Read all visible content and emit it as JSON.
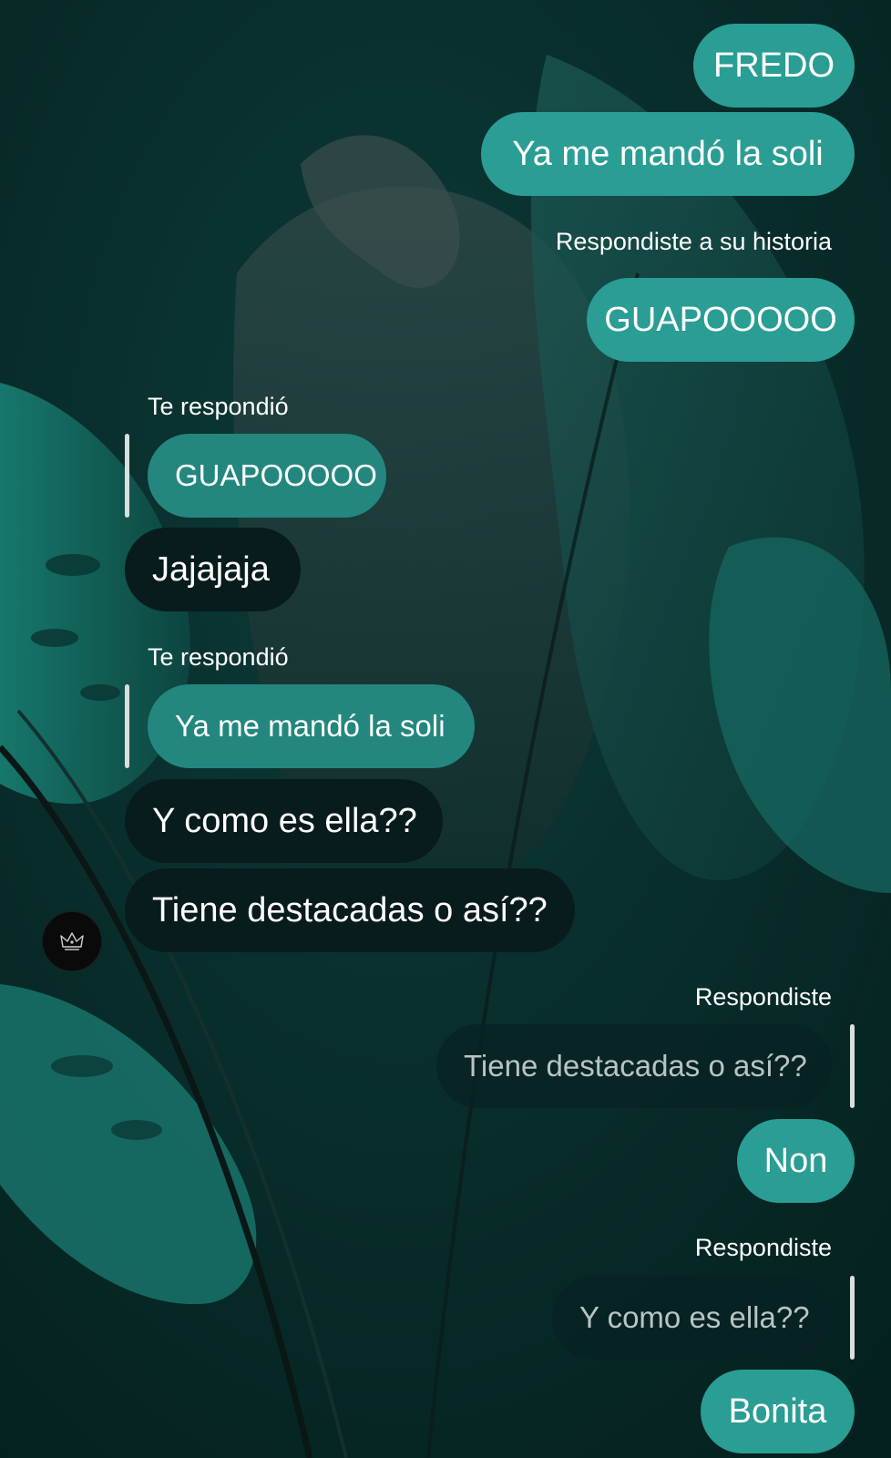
{
  "colors": {
    "background": "#062a28",
    "outgoing_bubble": "#2a9d94",
    "incoming_bubble": "#081b1d",
    "reply_quote_bubble": "#23877f"
  },
  "messages": {
    "m1": "FREDO",
    "m2": "Ya me mandó la soli",
    "label_story_reply": "Respondiste a su historia",
    "m3": "GUAPOOOOO",
    "label_replied_1": "Te respondió",
    "quote_1": "GUAPOOOOO",
    "m4": "Jajajaja",
    "label_replied_2": "Te respondió",
    "quote_2": "Ya me mandó la soli",
    "m5": "Y como es ella??",
    "m6": "Tiene destacadas o así??",
    "label_you_replied_1": "Respondiste",
    "quote_3": "Tiene destacadas o así??",
    "m7": "Non",
    "label_you_replied_2": "Respondiste",
    "quote_4": "Y como es ella??",
    "m8": "Bonita"
  },
  "contact": {
    "avatar_icon": "crown-icon"
  }
}
